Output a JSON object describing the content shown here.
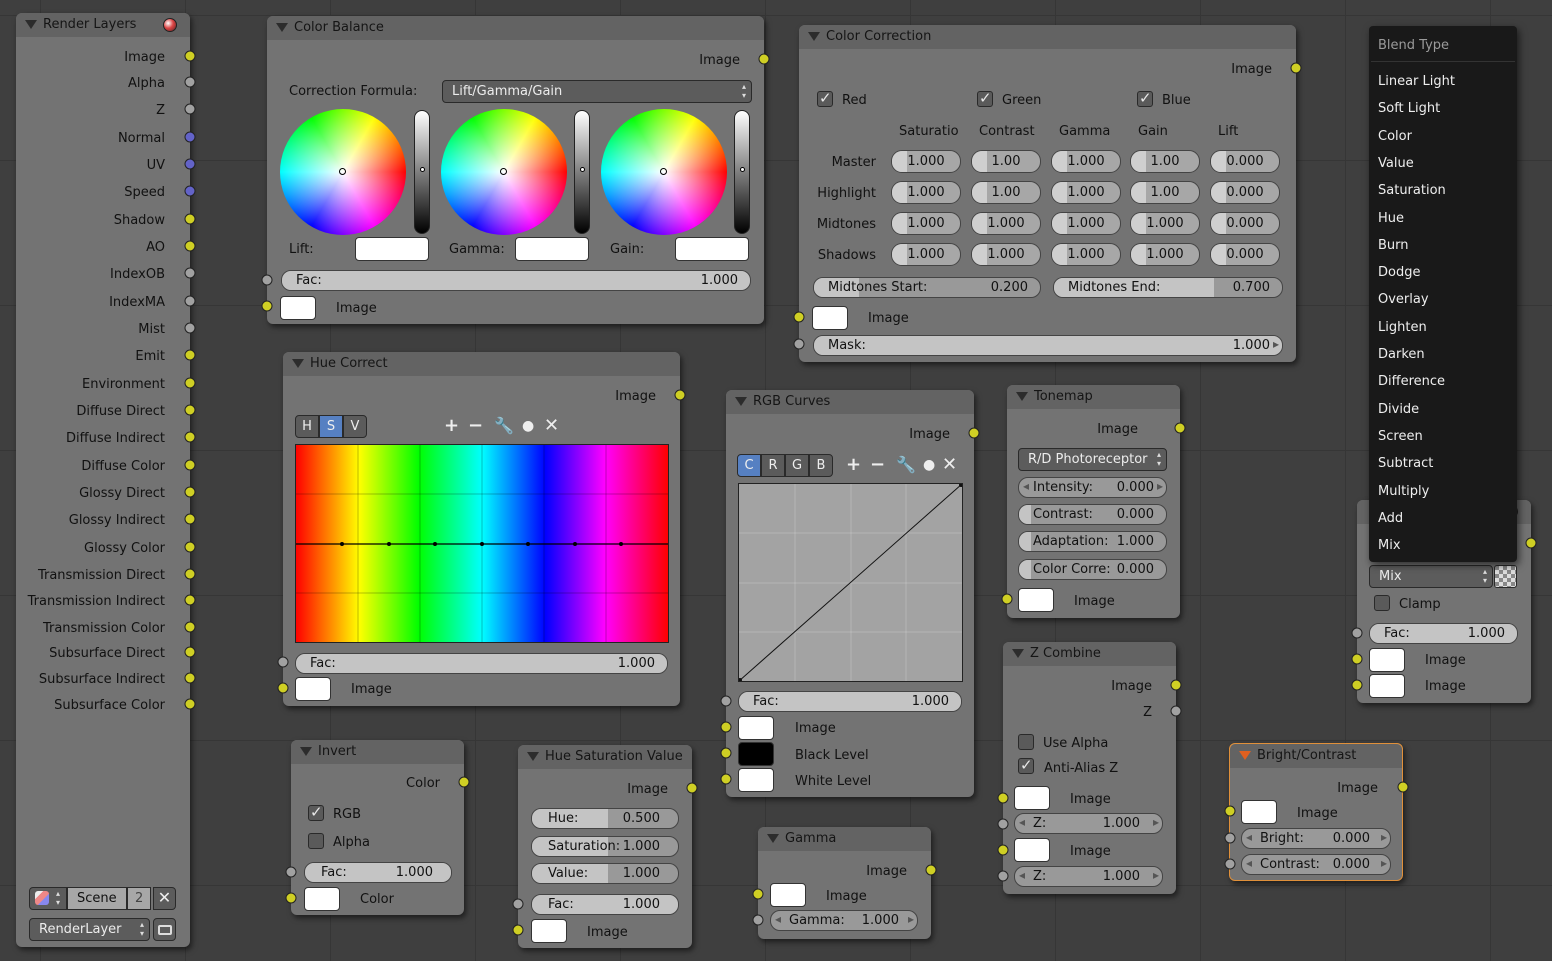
{
  "render_layers": {
    "title": "Render Layers",
    "outputs": [
      "Image",
      "Alpha",
      "Z",
      "Normal",
      "UV",
      "Speed",
      "Shadow",
      "AO",
      "IndexOB",
      "IndexMA",
      "Mist",
      "Emit",
      "Environment",
      "Diffuse Direct",
      "Diffuse Indirect",
      "Diffuse Color",
      "Glossy Direct",
      "Glossy Indirect",
      "Glossy Color",
      "Transmission Direct",
      "Transmission Indirect",
      "Transmission Color",
      "Subsurface Direct",
      "Subsurface Indirect",
      "Subsurface Color"
    ],
    "scene_label": "Scene",
    "scene_users": "2",
    "layer_value": "RenderLayer"
  },
  "color_balance": {
    "title": "Color Balance",
    "out_image": "Image",
    "formula_label": "Correction Formula:",
    "formula_value": "Lift/Gamma/Gain",
    "lift_label": "Lift:",
    "gamma_label": "Gamma:",
    "gain_label": "Gain:",
    "fac_label": "Fac:",
    "fac_value": "1.000",
    "in_image": "Image"
  },
  "color_correction": {
    "title": "Color Correction",
    "out_image": "Image",
    "red": "Red",
    "green": "Green",
    "blue": "Blue",
    "col_headers": [
      "Saturatio",
      "Contrast",
      "Gamma",
      "Gain",
      "Lift"
    ],
    "rows": [
      {
        "label": "Master",
        "values": [
          "1.000",
          "1.00",
          "1.000",
          "1.00",
          "0.000"
        ]
      },
      {
        "label": "Highlight",
        "values": [
          "1.000",
          "1.00",
          "1.000",
          "1.00",
          "0.000"
        ]
      },
      {
        "label": "Midtones",
        "values": [
          "1.000",
          "1.000",
          "1.000",
          "1.000",
          "0.000"
        ]
      },
      {
        "label": "Shadows",
        "values": [
          "1.000",
          "1.000",
          "1.000",
          "1.000",
          "0.000"
        ]
      }
    ],
    "midtones_start_label": "Midtones Start:",
    "midtones_start_value": "0.200",
    "midtones_end_label": "Midtones End:",
    "midtones_end_value": "0.700",
    "in_image": "Image",
    "mask_label": "Mask:",
    "mask_value": "1.000"
  },
  "blend_menu": {
    "header": "Blend Type",
    "items": [
      "Linear Light",
      "Soft Light",
      "Color",
      "Value",
      "Saturation",
      "Hue",
      "Burn",
      "Dodge",
      "Overlay",
      "Lighten",
      "Darken",
      "Difference",
      "Divide",
      "Screen",
      "Subtract",
      "Multiply",
      "Add",
      "Mix"
    ]
  },
  "mix": {
    "out_image": "Image",
    "blend_value": "Mix",
    "clamp_label": "Clamp",
    "fac_label": "Fac:",
    "fac_value": "1.000",
    "in_image1": "Image",
    "in_image2": "Image"
  },
  "hue_correct": {
    "title": "Hue Correct",
    "out_image": "Image",
    "tabs": [
      "H",
      "S",
      "V"
    ],
    "fac_label": "Fac:",
    "fac_value": "1.000",
    "in_image": "Image"
  },
  "rgb_curves": {
    "title": "RGB Curves",
    "out_image": "Image",
    "tabs": [
      "C",
      "R",
      "G",
      "B"
    ],
    "fac_label": "Fac:",
    "fac_value": "1.000",
    "in_image": "Image",
    "black_level": "Black Level",
    "white_level": "White Level"
  },
  "tonemap": {
    "title": "Tonemap",
    "out_image": "Image",
    "type_value": "R/D Photoreceptor",
    "intensity_label": "Intensity:",
    "intensity_value": "0.000",
    "contrast_label": "Contrast:",
    "contrast_value": "0.000",
    "adaptation_label": "Adaptation:",
    "adaptation_value": "1.000",
    "colorcorr_label": "Color Corre:",
    "colorcorr_value": "0.000",
    "in_image": "Image"
  },
  "z_combine": {
    "title": "Z Combine",
    "out_image": "Image",
    "out_z": "Z",
    "use_alpha": "Use Alpha",
    "anti_alias": "Anti-Alias Z",
    "in_image1": "Image",
    "z1_label": "Z:",
    "z1_value": "1.000",
    "in_image2": "Image",
    "z2_label": "Z:",
    "z2_value": "1.000"
  },
  "invert": {
    "title": "Invert",
    "out_color": "Color",
    "rgb": "RGB",
    "alpha": "Alpha",
    "fac_label": "Fac:",
    "fac_value": "1.000",
    "in_color": "Color"
  },
  "hsv": {
    "title": "Hue Saturation Value",
    "out_image": "Image",
    "hue_label": "Hue:",
    "hue_value": "0.500",
    "sat_label": "Saturation:",
    "sat_value": "1.000",
    "val_label": "Value:",
    "val_value": "1.000",
    "fac_label": "Fac:",
    "fac_value": "1.000",
    "in_image": "Image"
  },
  "gamma": {
    "title": "Gamma",
    "out_image": "Image",
    "in_image": "Image",
    "gamma_label": "Gamma:",
    "gamma_value": "1.000"
  },
  "bright_contrast": {
    "title": "Bright/Contrast",
    "out_image": "Image",
    "in_image": "Image",
    "bright_label": "Bright:",
    "bright_value": "0.000",
    "contrast_label": "Contrast:",
    "contrast_value": "0.000"
  },
  "colors": {
    "socket_color": "#cfcf24",
    "socket_gray": "#a1a1a1",
    "socket_vector": "#6363c8",
    "selected_tab": "#5680c2",
    "node_body": "#737373",
    "node_header": "#636363"
  }
}
